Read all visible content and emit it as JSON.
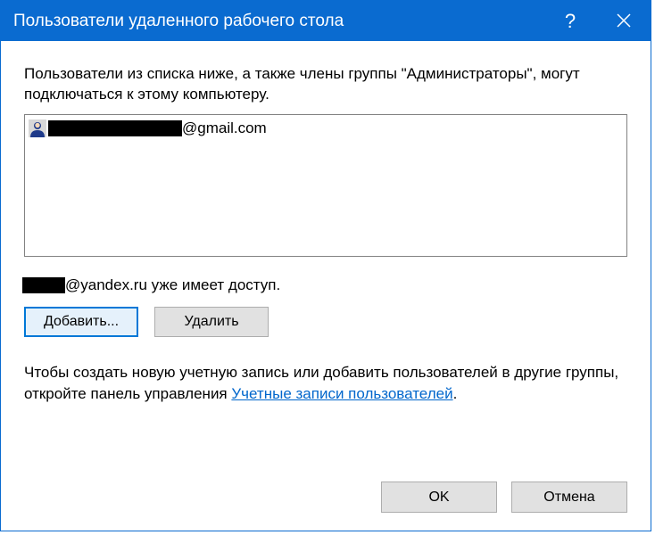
{
  "titlebar": {
    "title": "Пользователи удаленного рабочего стола",
    "help_label": "?",
    "close_label": "✕"
  },
  "description": "Пользователи из списка ниже, а также члены группы \"Администраторы\", могут подключаться к этому компьютеру.",
  "list": {
    "items": [
      {
        "email_suffix": "@gmail.com"
      }
    ]
  },
  "status": {
    "suffix": "@yandex.ru уже имеет доступ."
  },
  "buttons": {
    "add": "Добавить...",
    "remove": "Удалить"
  },
  "info": {
    "text_before": "Чтобы создать новую учетную запись или добавить пользователей в другие группы, откройте панель управления ",
    "link": "Учетные записи пользователей",
    "text_after": "."
  },
  "footer": {
    "ok": "OK",
    "cancel": "Отмена"
  }
}
